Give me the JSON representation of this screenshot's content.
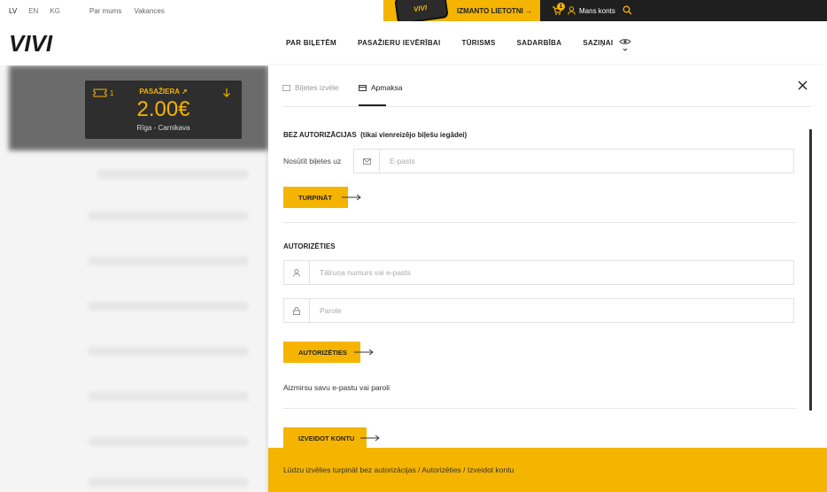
{
  "topbar": {
    "languages": [
      "LV",
      "EN",
      "KG"
    ],
    "links": [
      "Par mums",
      "Vakances"
    ],
    "app_promo_label": "IZMANTO LIETOTNI",
    "app_logo": "VIVI",
    "cart_count": "1",
    "account_label": "Mans konts"
  },
  "header": {
    "brand": "VIVI",
    "nav": [
      "PAR BIĻETĒM",
      "PASAŽIERU IEVĒRĪBAI",
      "TŪRISMS",
      "SADARBĪBA",
      "SAZIŅAI"
    ]
  },
  "ticket": {
    "count": "1",
    "type": "PASAŽIERA",
    "price": "2.00€",
    "route": "Rīga - Carnikava"
  },
  "panel": {
    "tabs": [
      "Biļetes izvēle",
      "Apmaksa"
    ],
    "guest": {
      "title": "BEZ AUTORIZĀCIJAS",
      "title_note": "(tikai vienreizējo biļešu iegādei)",
      "send_label": "Nosūtīt biļetes uz",
      "email_placeholder": "E-pasts",
      "continue_button": "TURPINĀT"
    },
    "login": {
      "title": "AUTORIZĒTIES",
      "user_placeholder": "Tālruņa numurs vai e-pasts",
      "password_placeholder": "Parole",
      "login_button": "AUTORIZĒTIES",
      "forgot_link": "Aizmirsu savu e-pastu vai paroli"
    },
    "register_button": "IZVEIDOT KONTU"
  },
  "notice": "Lūdzu izvēlies turpināt bez autorizācijas / Autorizēties / Izveidot kontu",
  "colors": {
    "accent": "#f5b400",
    "dark": "#1f1f1f"
  }
}
